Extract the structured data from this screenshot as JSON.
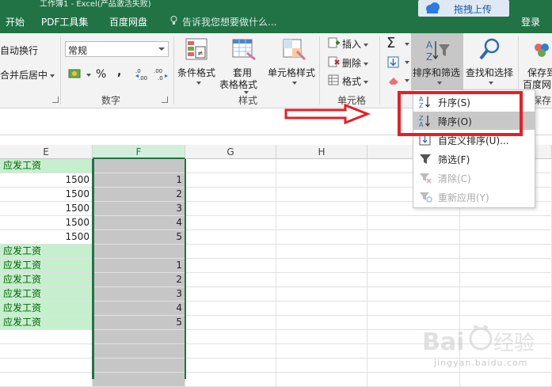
{
  "window": {
    "title": "工作簿1 - Excel(产品激活失败)"
  },
  "tabs": [
    {
      "label": "开始"
    },
    {
      "label": "PDF工具集"
    },
    {
      "label": "百度网盘"
    }
  ],
  "tell_me": "告诉我您想要做什么...",
  "baidu_upload": {
    "label": "拖拽上传"
  },
  "login": "登录",
  "ribbon": {
    "alignment": {
      "wrap_text": "自动换行",
      "merge_center": "合并后居中"
    },
    "number": {
      "format_value": "常规",
      "percent": "%",
      "comma": ",",
      "inc_decimal": "←.0\n.00",
      "dec_decimal": ".00\n→.0",
      "group_label": "数字"
    },
    "styles": {
      "conditional": "条件格式",
      "table_format_1": "套用",
      "table_format_2": "表格格式",
      "cell_styles": "单元格样式",
      "group_label": "样式"
    },
    "cells": {
      "insert": "插入",
      "delete": "删除",
      "format": "格式",
      "group_label": "单元格"
    },
    "editing": {
      "sort_filter": "排序和筛选",
      "find_select": "查找和选择"
    },
    "save": {
      "line1": "保存到",
      "line2": "百度网",
      "group_label": "保存"
    }
  },
  "columns": [
    "E",
    "F",
    "G",
    "H"
  ],
  "rows": [
    {
      "E": "应发工资",
      "E_type": "green",
      "F": ""
    },
    {
      "E": "1500",
      "E_type": "num",
      "F": "1"
    },
    {
      "E": "1500",
      "E_type": "num",
      "F": "2"
    },
    {
      "E": "1500",
      "E_type": "num",
      "F": "3"
    },
    {
      "E": "1500",
      "E_type": "num",
      "F": "4"
    },
    {
      "E": "1500",
      "E_type": "num",
      "F": "5"
    },
    {
      "E": "应发工资",
      "E_type": "green",
      "F": ""
    },
    {
      "E": "应发工资",
      "E_type": "green",
      "F": "1"
    },
    {
      "E": "应发工资",
      "E_type": "green",
      "F": "2"
    },
    {
      "E": "应发工资",
      "E_type": "green",
      "F": "3"
    },
    {
      "E": "应发工资",
      "E_type": "green",
      "F": "4"
    },
    {
      "E": "应发工资",
      "E_type": "green",
      "F": "5"
    },
    {
      "E": "",
      "E_type": "plain",
      "F": ""
    },
    {
      "E": "",
      "E_type": "plain",
      "F": ""
    },
    {
      "E": "",
      "E_type": "plain",
      "F": ""
    },
    {
      "E": "",
      "E_type": "plain",
      "F": ""
    }
  ],
  "sort_menu": [
    {
      "label": "升序(S)",
      "icon": "sort-ascending-icon",
      "state": "normal"
    },
    {
      "label": "降序(O)",
      "icon": "sort-descending-icon",
      "state": "highlighted"
    },
    {
      "label": "自定义排序(U)...",
      "icon": "custom-sort-icon",
      "state": "normal"
    },
    {
      "label": "筛选(F)",
      "icon": "filter-icon",
      "state": "normal"
    },
    {
      "label": "清除(C)",
      "icon": "clear-filter-icon",
      "state": "disabled"
    },
    {
      "label": "重新应用(Y)",
      "icon": "reapply-icon",
      "state": "disabled"
    }
  ],
  "watermark": {
    "brand": "Bai",
    "brand_cn": "经验",
    "url": "jingyan.baidu.com"
  },
  "colors": {
    "excel_green": "#217346",
    "highlight_red": "#e81e25",
    "good_fill": "#c6efce",
    "good_text": "#006100",
    "selection_gray": "#c6c6c6"
  }
}
